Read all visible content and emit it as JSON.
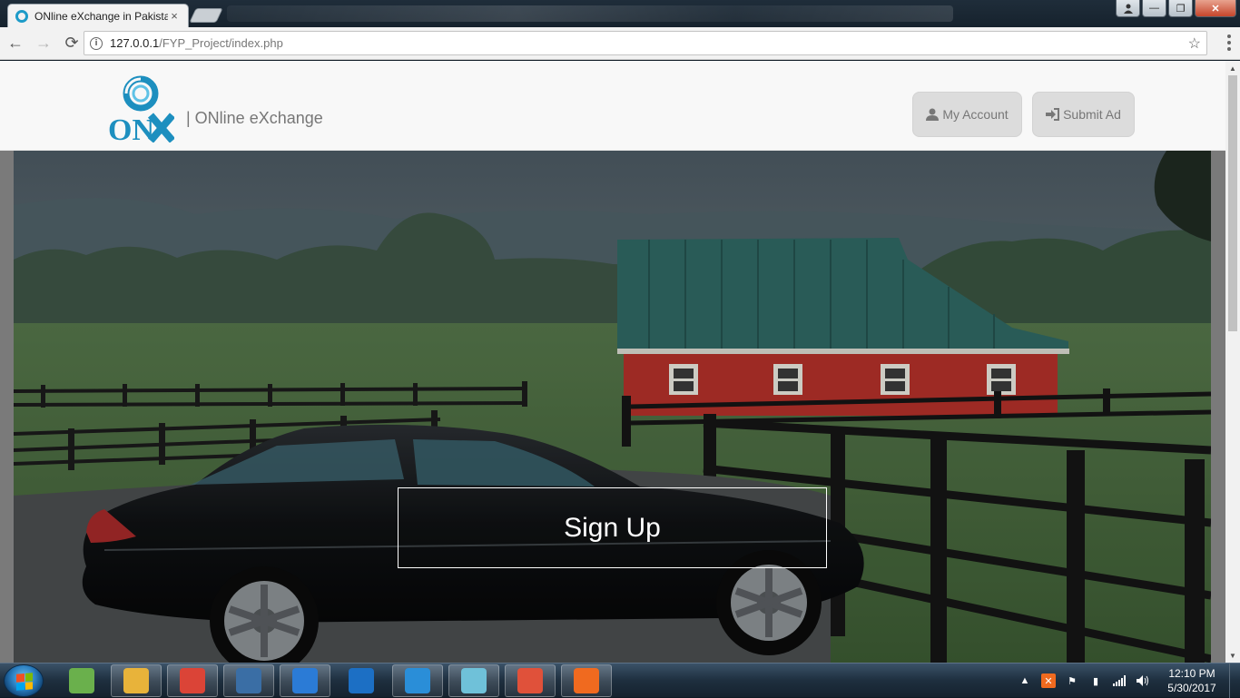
{
  "browser": {
    "tab_title": "ONline eXchange in Pakistan",
    "tab_close": "×",
    "url_host": "127.0.0.1",
    "url_path": "/FYP_Project/index.php",
    "info_glyph": "i",
    "back_glyph": "←",
    "forward_glyph": "→",
    "reload_glyph": "⟳",
    "star_glyph": "☆",
    "window_buttons": {
      "minimize": "—",
      "maximize": "❐",
      "close": "✕"
    }
  },
  "site": {
    "brand_text": "| ONline eXchange",
    "logo_icon": "onx-logo",
    "nav": {
      "my_account": "My Account",
      "my_account_icon": "user-icon",
      "submit_ad": "Submit Ad",
      "submit_ad_icon": "sign-in-icon"
    },
    "hero": {
      "signup_label": "Sign Up",
      "image": "black-sedan-farm-barn"
    }
  },
  "taskbar": {
    "clock_time": "12:10 PM",
    "clock_date": "5/30/2017",
    "tray_arrow": "▲",
    "items": [
      {
        "name": "android-studio",
        "label": "",
        "color": "#6ab04c"
      },
      {
        "name": "file-explorer",
        "label": "",
        "color": "#e8b33a"
      },
      {
        "name": "chrome",
        "label": "",
        "color": "#db4437"
      },
      {
        "name": "task-manager",
        "label": "",
        "color": "#3a6ea5"
      },
      {
        "name": "globe",
        "label": "",
        "color": "#2b7bd6"
      },
      {
        "name": "visual-studio-code",
        "label": "",
        "color": "#1c6fc4"
      },
      {
        "name": "brackets",
        "label": "",
        "color": "#2a8ed8"
      },
      {
        "name": "notepad",
        "label": "",
        "color": "#6fc1d9"
      },
      {
        "name": "git",
        "label": "",
        "color": "#e0513a"
      },
      {
        "name": "xampp",
        "label": "",
        "color": "#f06a1f"
      }
    ]
  },
  "colors": {
    "header_bg": "#f8f8f8",
    "header_button_bg": "#dcdcdc",
    "logo_blue": "#1d8fbf",
    "barn_red": "#b3302a",
    "roof_green": "#2f6864"
  }
}
